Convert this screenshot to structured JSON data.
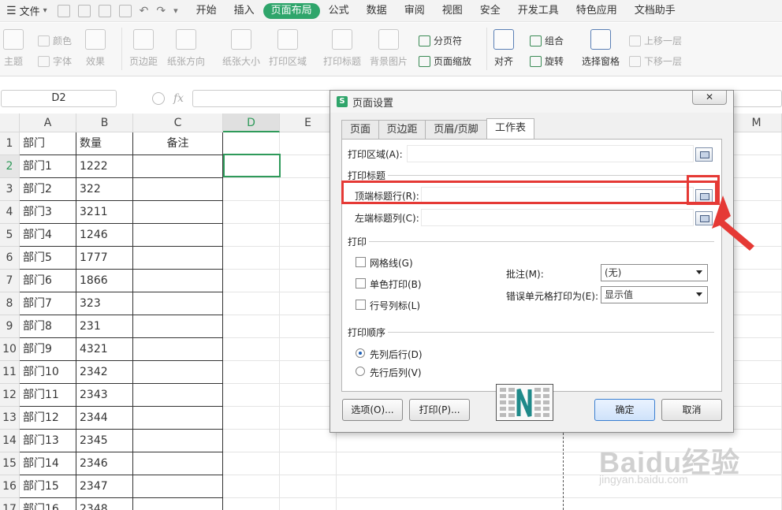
{
  "menubar": {
    "file": "文件",
    "tabs": [
      "开始",
      "插入",
      "页面布局",
      "公式",
      "数据",
      "审阅",
      "视图",
      "安全",
      "开发工具",
      "特色应用",
      "文档助手"
    ],
    "active_tab": "页面布局"
  },
  "ribbon": {
    "theme": "主题",
    "color": "颜色",
    "font": "字体",
    "effect": "效果",
    "margins": "页边距",
    "orientation": "纸张方向",
    "size": "纸张大小",
    "print_area": "打印区域",
    "print_titles": "打印标题",
    "background": "背景图片",
    "page_break": "分页符",
    "page_zoom": "页面缩放",
    "align": "对齐",
    "group": "组合",
    "rotate": "旋转",
    "selection_pane": "选择窗格",
    "bring_forward": "上移一层",
    "send_backward": "下移一层"
  },
  "formula_bar": {
    "name_box": "D2",
    "fx": "fx",
    "formula": ""
  },
  "sheet": {
    "columns": [
      "A",
      "B",
      "C",
      "D",
      "E",
      "M"
    ],
    "selected_column": "D",
    "rows": [
      "1",
      "2",
      "3",
      "4",
      "5",
      "6",
      "7",
      "8",
      "9",
      "10",
      "11",
      "12",
      "13",
      "14",
      "15",
      "16",
      "17"
    ],
    "selected_row": "2",
    "header_row": [
      "部门",
      "数量",
      "备注"
    ],
    "data": [
      [
        "部门1",
        "1222"
      ],
      [
        "部门2",
        "322"
      ],
      [
        "部门3",
        "3211"
      ],
      [
        "部门4",
        "1246"
      ],
      [
        "部门5",
        "1777"
      ],
      [
        "部门6",
        "1866"
      ],
      [
        "部门7",
        "323"
      ],
      [
        "部门8",
        "231"
      ],
      [
        "部门9",
        "4321"
      ],
      [
        "部门10",
        "2342"
      ],
      [
        "部门11",
        "2343"
      ],
      [
        "部门12",
        "2344"
      ],
      [
        "部门13",
        "2345"
      ],
      [
        "部门14",
        "2346"
      ],
      [
        "部门15",
        "2347"
      ],
      [
        "部门16",
        "2348"
      ]
    ]
  },
  "dialog": {
    "title": "页面设置",
    "close": "✕",
    "tabs": [
      "页面",
      "页边距",
      "页眉/页脚",
      "工作表"
    ],
    "active_tab": "工作表",
    "print_area_label": "打印区域(A):",
    "print_area_value": "",
    "print_titles_section": "打印标题",
    "top_rows_label": "顶端标题行(R):",
    "top_rows_value": "",
    "left_cols_label": "左端标题列(C):",
    "left_cols_value": "",
    "print_section": "打印",
    "gridlines": "网格线(G)",
    "gridlines_checked": false,
    "mono": "单色打印(B)",
    "mono_checked": false,
    "rowcol_headers": "行号列标(L)",
    "rowcol_checked": false,
    "comments_label": "批注(M):",
    "comments_value": "(无)",
    "errors_label": "错误单元格打印为(E):",
    "errors_value": "显示值",
    "order_section": "打印顺序",
    "order_down_then_over": "先列后行(D)",
    "order_over_then_down": "先行后列(V)",
    "order_selected": "先列后行(D)",
    "options_button": "选项(O)...",
    "print_button": "打印(P)...",
    "ok_button": "确定",
    "cancel_button": "取消"
  },
  "watermark": {
    "brand": "Baidu经验",
    "url": "jingyan.baidu.com"
  },
  "colors": {
    "accent": "#2fa56b",
    "annotation": "#e53935",
    "selection": "#2f9a5a"
  }
}
